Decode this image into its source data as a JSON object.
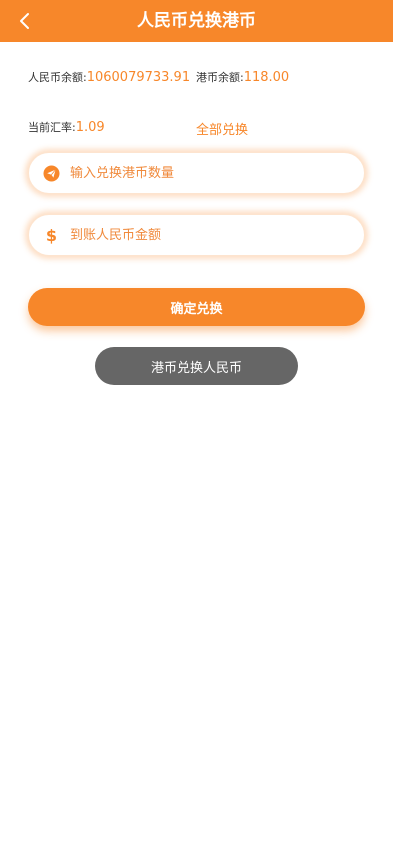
{
  "header": {
    "title": "人民币兑换港币",
    "back_icon": "chevron-left-icon"
  },
  "balances": {
    "cny_label": "人民币余额:",
    "cny_value": "1060079733.91",
    "hkd_label": "港币余额:",
    "hkd_value": "118.00"
  },
  "rate": {
    "label": "当前汇率:",
    "value": "1.09",
    "exchange_all": "全部兑换"
  },
  "inputs": {
    "hkd_amount_placeholder": "输入兑换港币数量",
    "hkd_amount_icon": "send-icon",
    "cny_amount_placeholder": "到账人民币金额",
    "cny_amount_icon": "dollar-icon"
  },
  "buttons": {
    "confirm": "确定兑换",
    "switch": "港币兑换人民币"
  },
  "colors": {
    "accent": "#f7872a",
    "switch_button": "#666666"
  }
}
